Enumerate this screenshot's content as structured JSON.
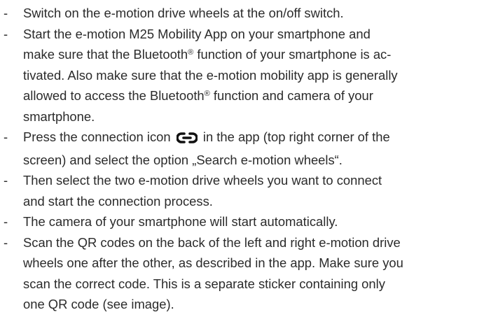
{
  "instructions": [
    {
      "text": "Switch on the e-motion drive wheels at the on/off switch."
    },
    {
      "text_a": "Start the e-motion M25 Mobility App on your smartphone and",
      "text_b": "make sure that the Bluetooth",
      "reg": "®",
      "text_c": " function of your smartphone is ac-",
      "text_d": "tivated. Also make sure that the e-motion mobility app is generally",
      "text_e": "allowed to access the Bluetooth",
      "text_f": " function and camera of your",
      "text_g": "smartphone."
    },
    {
      "before_icon": "Press the connection icon",
      "icon": "link-icon",
      "after_icon": "in the app (top right corner of the",
      "line2": "screen) and select the option „Search e-motion wheels“."
    },
    {
      "line1": "Then select the two e-motion drive wheels you want to connect",
      "line2": "and start the connection process."
    },
    {
      "text": "The camera of your smartphone will start automatically."
    },
    {
      "line1": "Scan the QR codes on the back of the left and right e-motion drive",
      "line2": "wheels one after the other, as described in the app. Make sure you",
      "line3": "scan the correct code. This is a separate sticker containing only",
      "line4": "one QR code (see image)."
    }
  ],
  "bullet": "-",
  "colors": {
    "text": "#2b2b2b",
    "background": "#ffffff"
  }
}
